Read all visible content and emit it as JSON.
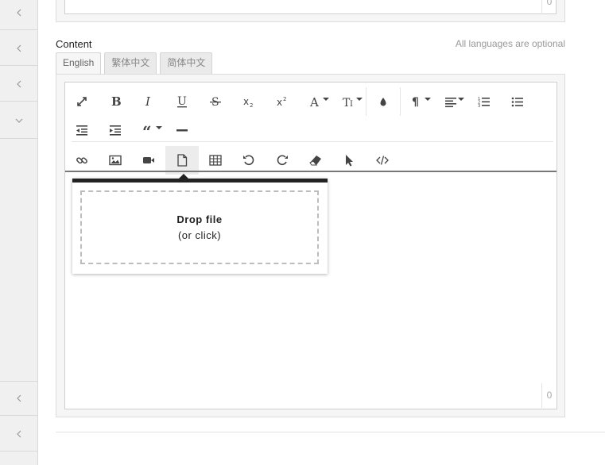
{
  "previous_field": {
    "char_count": "0"
  },
  "content_field": {
    "label": "Content",
    "hint": "All languages are optional",
    "tabs": [
      {
        "label": "English",
        "active": true
      },
      {
        "label": "繁体中文",
        "active": false
      },
      {
        "label": "简体中文",
        "active": false
      }
    ],
    "toolbar_row1": [
      "fullscreen-icon",
      "bold-icon",
      "italic-icon",
      "underline-icon",
      "strikethrough-icon",
      "subscript-icon",
      "superscript-icon",
      "font-family-icon",
      "font-size-icon",
      "color-icon",
      "paragraph-format-icon",
      "align-icon",
      "ordered-list-icon",
      "unordered-list-icon"
    ],
    "toolbar_row2": [
      "outdent-icon",
      "indent-icon",
      "quote-icon",
      "horizontal-line-icon"
    ],
    "toolbar_row3": [
      "insert-link-icon",
      "insert-image-icon",
      "insert-video-icon",
      "insert-file-icon",
      "insert-table-icon",
      "undo-icon",
      "redo-icon",
      "clear-formatting-icon",
      "select-all-icon",
      "code-view-icon"
    ],
    "file_popup": {
      "drop_title": "Drop file",
      "drop_subtitle": "(or click)"
    },
    "char_count": "0"
  },
  "colors": {
    "accent_dark": "#222222",
    "panel_bg": "#f6f6f6",
    "rail_bg": "#f0f0f0"
  }
}
